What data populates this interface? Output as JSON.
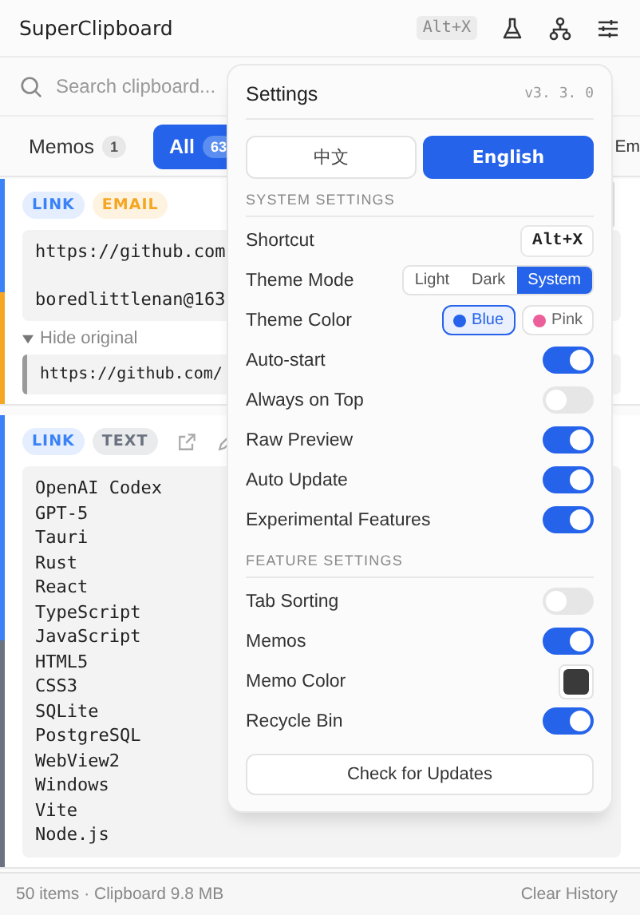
{
  "header": {
    "title": "SuperClipboard",
    "shortcut": "Alt+X"
  },
  "search": {
    "placeholder": "Search clipboard..."
  },
  "tabs": [
    {
      "label": "Memos",
      "count": "1",
      "selected": false
    },
    {
      "label": "All",
      "count": "63",
      "selected": true
    },
    {
      "label": "Em",
      "selected": false
    }
  ],
  "items": [
    {
      "hovered": false,
      "tags": [
        {
          "label": "LINK",
          "color": "#3b82f6"
        },
        {
          "label": "EMAIL",
          "color": "#f5a623"
        }
      ],
      "spaced": true,
      "lines": [
        "https://github.com",
        "boredlittlenan@163"
      ],
      "original": {
        "expanded": true,
        "toggle_label": "Hide original",
        "text": "https://github.com/"
      }
    },
    {
      "hovered": true,
      "spaced": false,
      "tags": [
        {
          "label": "LINK",
          "color": "#3b82f6"
        },
        {
          "label": "TEXT",
          "color": "#6b7280"
        }
      ],
      "lines": [
        "OpenAI Codex",
        "GPT-5",
        "Tauri",
        "Rust",
        "React",
        "TypeScript",
        "JavaScript",
        "HTML5",
        "CSS3",
        "SQLite",
        "PostgreSQL",
        "WebView2",
        "Windows",
        "Vite",
        "Node.js"
      ]
    }
  ],
  "status_bar": {
    "summary": "50 items · Clipboard 9.8 MB",
    "clear_label": "Clear History"
  },
  "settings": {
    "title": "Settings",
    "version": "v3. 3. 0",
    "languages": [
      {
        "label": "中文",
        "selected": false
      },
      {
        "label": "English",
        "selected": true
      }
    ],
    "sections": [
      {
        "title": "SYSTEM SETTINGS",
        "rows": [
          {
            "kind": "key",
            "label": "Shortcut",
            "value": "Alt+X"
          },
          {
            "kind": "segmented",
            "label": "Theme Mode",
            "options": [
              {
                "label": "Light",
                "selected": false
              },
              {
                "label": "Dark",
                "selected": false
              },
              {
                "label": "System",
                "selected": true
              }
            ]
          },
          {
            "kind": "swatches",
            "label": "Theme Color",
            "options": [
              {
                "label": "Blue",
                "color": "#2563eb",
                "selected": true
              },
              {
                "label": "Pink",
                "color": "#ec5f9a",
                "selected": false
              }
            ]
          },
          {
            "kind": "toggle",
            "label": "Auto-start",
            "on": true
          },
          {
            "kind": "toggle",
            "label": "Always on Top",
            "on": false
          },
          {
            "kind": "toggle",
            "label": "Raw Preview",
            "on": true
          },
          {
            "kind": "toggle",
            "label": "Auto Update",
            "on": true
          },
          {
            "kind": "toggle",
            "label": "Experimental Features",
            "on": true
          }
        ]
      },
      {
        "title": "FEATURE SETTINGS",
        "rows": [
          {
            "kind": "toggle",
            "label": "Tab Sorting",
            "on": false
          },
          {
            "kind": "toggle",
            "label": "Memos",
            "on": true
          },
          {
            "kind": "color",
            "label": "Memo Color",
            "color": "#3a3a3a"
          },
          {
            "kind": "toggle",
            "label": "Recycle Bin",
            "on": true
          }
        ]
      }
    ],
    "check_button": "Check for Updates"
  }
}
